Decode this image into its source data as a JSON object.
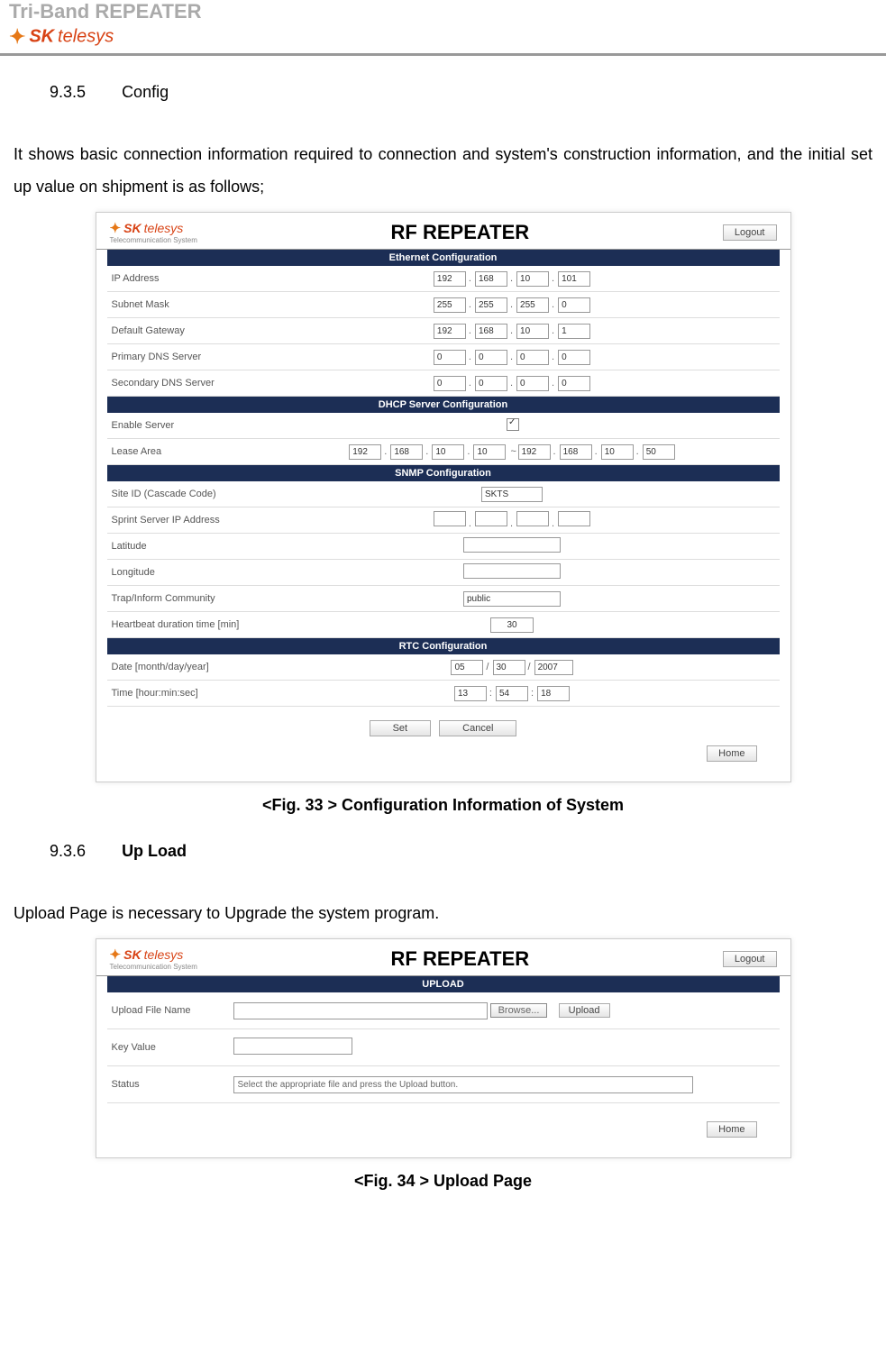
{
  "page_header_title": "Tri-Band REPEATER",
  "logo_sk": "SK",
  "logo_telesys": "telesys",
  "section_935_num": "9.3.5",
  "section_935_title": "Config",
  "body_935": "It shows basic connection information required to connection and system's construction information, and the initial set up value on shipment is as follows;",
  "fig33": {
    "logo_sub": "Telecommunication System",
    "title": "RF  REPEATER",
    "logout": "Logout",
    "band_ethernet": "Ethernet Configuration",
    "ip_addr_label": "IP Address",
    "ip_addr": [
      "192",
      "168",
      "10",
      "101"
    ],
    "subnet_label": "Subnet Mask",
    "subnet": [
      "255",
      "255",
      "255",
      "0"
    ],
    "gw_label": "Default Gateway",
    "gw": [
      "192",
      "168",
      "10",
      "1"
    ],
    "pdns_label": "Primary DNS Server",
    "pdns": [
      "0",
      "0",
      "0",
      "0"
    ],
    "sdns_label": "Secondary DNS Server",
    "sdns": [
      "0",
      "0",
      "0",
      "0"
    ],
    "band_dhcp": "DHCP Server Configuration",
    "enable_label": "Enable Server",
    "lease_label": "Lease Area",
    "lease_a": [
      "192",
      "168",
      "10",
      "10"
    ],
    "lease_b": [
      "192",
      "168",
      "10",
      "50"
    ],
    "band_snmp": "SNMP Configuration",
    "site_label": "Site ID (Cascade Code)",
    "site_val": "SKTS",
    "sprint_label": "Sprint Server IP Address",
    "lat_label": "Latitude",
    "lon_label": "Longitude",
    "trap_label": "Trap/Inform Community",
    "trap_val": "public",
    "hb_label": "Heartbeat duration time [min]",
    "hb_val": "30",
    "band_rtc": "RTC Configuration",
    "date_label": "Date [month/day/year]",
    "date_vals": [
      "05",
      "30",
      "2007"
    ],
    "time_label": "Time [hour:min:sec]",
    "time_vals": [
      "13",
      "54",
      "18"
    ],
    "btn_set": "Set",
    "btn_cancel": "Cancel",
    "btn_home": "Home"
  },
  "caption33": "<Fig. 33 > Configuration Information of System",
  "section_936_num": "9.3.6",
  "section_936_title": "Up Load",
  "body_936": "Upload Page is necessary to Upgrade the system program.",
  "fig34": {
    "title": "RF  REPEATER",
    "logout": "Logout",
    "band_upload": "UPLOAD",
    "file_label": "Upload File Name",
    "browse": "Browse...",
    "upload_btn": "Upload",
    "key_label": "Key Value",
    "status_label": "Status",
    "status_val": "Select the appropriate file and press the Upload button.",
    "btn_home": "Home"
  },
  "caption34": "<Fig. 34 > Upload Page"
}
